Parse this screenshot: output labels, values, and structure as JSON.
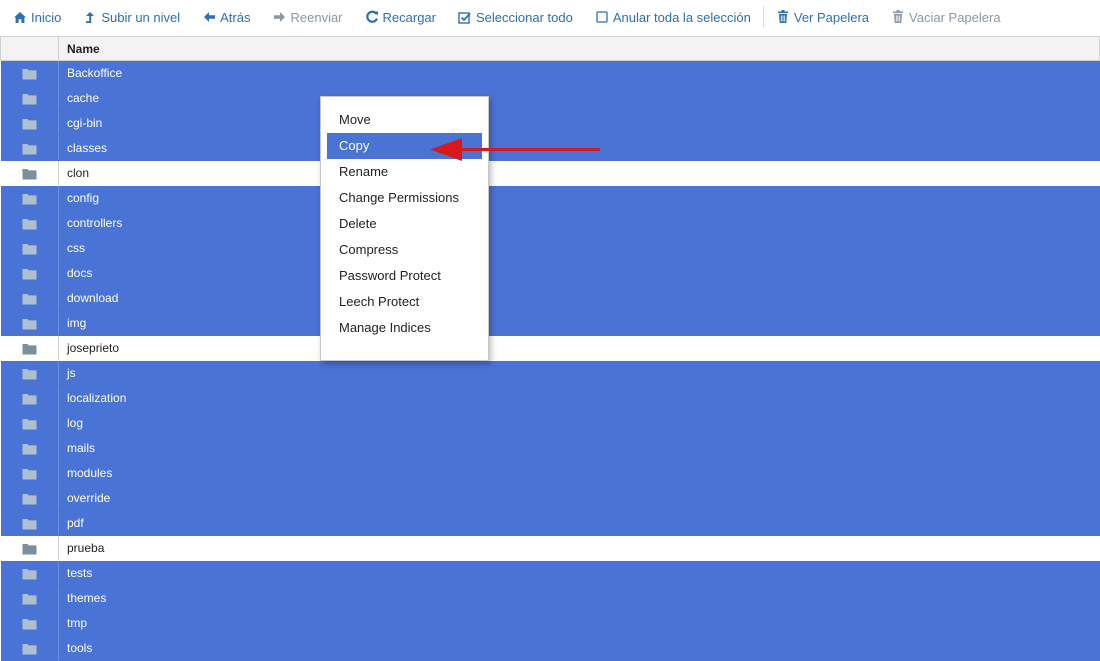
{
  "toolbar": {
    "items": [
      {
        "label": "Inicio",
        "icon": "home-icon",
        "enabled": true
      },
      {
        "label": "Subir un nivel",
        "icon": "level-up-icon",
        "enabled": true
      },
      {
        "label": "Atrás",
        "icon": "arrow-left-icon",
        "enabled": true
      },
      {
        "label": "Reenviar",
        "icon": "arrow-right-icon",
        "enabled": false
      },
      {
        "label": "Recargar",
        "icon": "refresh-icon",
        "enabled": true
      },
      {
        "label": "Seleccionar todo",
        "icon": "check-square-icon",
        "enabled": true
      },
      {
        "label": "Anular toda la selección",
        "icon": "empty-square-icon",
        "enabled": true
      },
      {
        "label": "Ver Papelera",
        "icon": "trash-icon",
        "enabled": true
      },
      {
        "label": "Vaciar Papelera",
        "icon": "trash-icon",
        "enabled": false
      }
    ]
  },
  "table": {
    "header_name": "Name",
    "rows": [
      {
        "name": "Backoffice",
        "selected": true
      },
      {
        "name": "cache",
        "selected": true
      },
      {
        "name": "cgi-bin",
        "selected": true
      },
      {
        "name": "classes",
        "selected": true
      },
      {
        "name": "clon",
        "selected": false
      },
      {
        "name": "config",
        "selected": true
      },
      {
        "name": "controllers",
        "selected": true
      },
      {
        "name": "css",
        "selected": true
      },
      {
        "name": "docs",
        "selected": true
      },
      {
        "name": "download",
        "selected": true
      },
      {
        "name": "img",
        "selected": true
      },
      {
        "name": "joseprieto",
        "selected": false
      },
      {
        "name": "js",
        "selected": true
      },
      {
        "name": "localization",
        "selected": true
      },
      {
        "name": "log",
        "selected": true
      },
      {
        "name": "mails",
        "selected": true
      },
      {
        "name": "modules",
        "selected": true
      },
      {
        "name": "override",
        "selected": true
      },
      {
        "name": "pdf",
        "selected": true
      },
      {
        "name": "prueba",
        "selected": false
      },
      {
        "name": "tests",
        "selected": true
      },
      {
        "name": "themes",
        "selected": true
      },
      {
        "name": "tmp",
        "selected": true
      },
      {
        "name": "tools",
        "selected": true
      }
    ]
  },
  "context_menu": {
    "items": [
      {
        "label": "Move",
        "active": false
      },
      {
        "label": "Copy",
        "active": true
      },
      {
        "label": "Rename",
        "active": false
      },
      {
        "label": "Change Permissions",
        "active": false
      },
      {
        "label": "Delete",
        "active": false
      },
      {
        "label": "Compress",
        "active": false
      },
      {
        "label": "Password Protect",
        "active": false
      },
      {
        "label": "Leech Protect",
        "active": false
      },
      {
        "label": "Manage Indices",
        "active": false
      }
    ]
  },
  "colors": {
    "selection": "#4a73d6",
    "link": "#2f6fb0",
    "annotation_arrow": "#d9181e",
    "folder_on_selected": "#aebfd0",
    "folder_on_white": "#7d8f9f"
  }
}
